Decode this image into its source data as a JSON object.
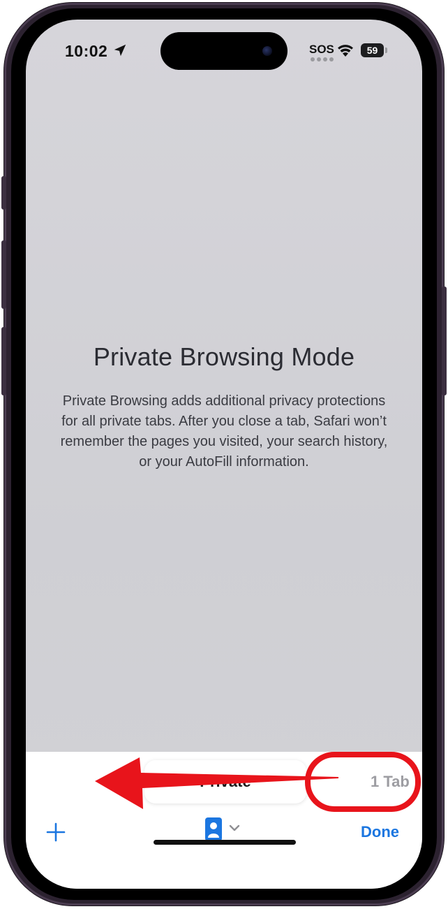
{
  "status_bar": {
    "time": "10:02",
    "carrier": "SOS",
    "battery": "59"
  },
  "content": {
    "title": "Private Browsing Mode",
    "description": "Private Browsing adds additional privacy protections for all private tabs. After you close a tab, Safari won’t remember the pages you visited, your search history, or your AutoFill information."
  },
  "toolbar": {
    "tab_group_label": "Private",
    "tab_count": "1 Tab",
    "done_label": "Done",
    "new_tab_icon": "plus-icon",
    "tab_group_icon": "tab-group-icon"
  },
  "colors": {
    "accent": "#1b76e0",
    "annotation": "#e8141b"
  }
}
